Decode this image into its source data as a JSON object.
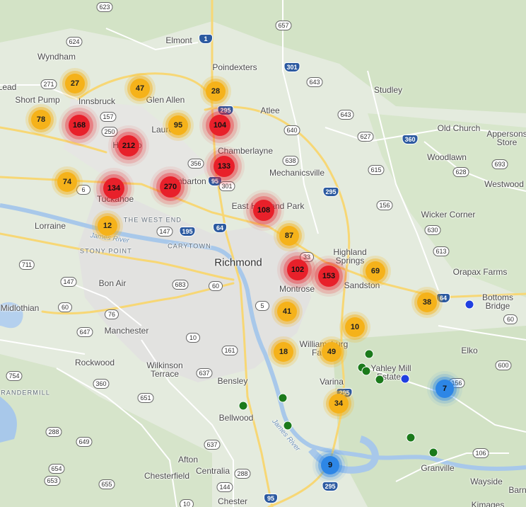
{
  "map": {
    "city": "Richmond",
    "places": [
      "Elmont",
      "Wyndham",
      "Poindexters",
      "Studley",
      "Short Pump",
      "Innsbruck",
      "Glen Allen",
      "Atlee",
      "Laurel",
      "Old Church",
      "Appersons Store",
      "Chamberlayne",
      "Mechanicsville",
      "Woodlawn",
      "Westwood",
      "Tuckahoe",
      "Dumbarton",
      "East Highland Park",
      "Wicker Corner",
      "Lorraine",
      "Highland Springs",
      "Orapax Farms",
      "Sandston",
      "Bon Air",
      "Montrose",
      "Bottoms Bridge",
      "Midlothian",
      "Manchester",
      "Elko",
      "Williamsburg Farms",
      "Rockwood",
      "Wilkinson Terrace",
      "Yahley Mill Estates",
      "Bensley",
      "Varina",
      "Bellwood",
      "Afton",
      "Centralia",
      "Chesterfield",
      "Granville",
      "Wayside",
      "Chester",
      "Barn",
      "Kimages",
      "Henrico",
      "Lead"
    ],
    "areas": [
      "THE WEST END",
      "STONY POINT",
      "CARYTOWN",
      "GRANDERMILL"
    ],
    "river": "James River",
    "route_shields": [
      "623",
      "1",
      "657",
      "624",
      "271",
      "301",
      "643",
      "295",
      "157",
      "250",
      "643",
      "640",
      "627",
      "360",
      "628",
      "693",
      "356",
      "638",
      "615",
      "6",
      "95",
      "301",
      "64",
      "295",
      "156",
      "147",
      "195",
      "630",
      "33",
      "613",
      "711",
      "147",
      "683",
      "60",
      "5",
      "60",
      "64",
      "60",
      "76",
      "600",
      "647",
      "10",
      "161",
      "754",
      "360",
      "637",
      "156",
      "651",
      "295",
      "288",
      "649",
      "637",
      "106",
      "654",
      "653",
      "655",
      "288",
      "144",
      "95",
      "295",
      "10"
    ],
    "clusters": [
      {
        "count": "27",
        "level": "orange"
      },
      {
        "count": "47",
        "level": "orange"
      },
      {
        "count": "28",
        "level": "orange"
      },
      {
        "count": "78",
        "level": "orange"
      },
      {
        "count": "168",
        "level": "red"
      },
      {
        "count": "212",
        "level": "red"
      },
      {
        "count": "95",
        "level": "orange"
      },
      {
        "count": "104",
        "level": "red"
      },
      {
        "count": "133",
        "level": "red"
      },
      {
        "count": "74",
        "level": "orange"
      },
      {
        "count": "134",
        "level": "red"
      },
      {
        "count": "270",
        "level": "red"
      },
      {
        "count": "108",
        "level": "red"
      },
      {
        "count": "12",
        "level": "orange"
      },
      {
        "count": "87",
        "level": "orange"
      },
      {
        "count": "102",
        "level": "red"
      },
      {
        "count": "153",
        "level": "red"
      },
      {
        "count": "69",
        "level": "orange"
      },
      {
        "count": "38",
        "level": "orange"
      },
      {
        "count": "41",
        "level": "orange"
      },
      {
        "count": "10",
        "level": "orange"
      },
      {
        "count": "18",
        "level": "orange"
      },
      {
        "count": "49",
        "level": "orange"
      },
      {
        "count": "7",
        "level": "blue"
      },
      {
        "count": "34",
        "level": "orange"
      },
      {
        "count": "9",
        "level": "blue"
      }
    ],
    "marker_colors": {
      "green": "#1b7a1b",
      "blue": "#1f3fe0"
    }
  }
}
